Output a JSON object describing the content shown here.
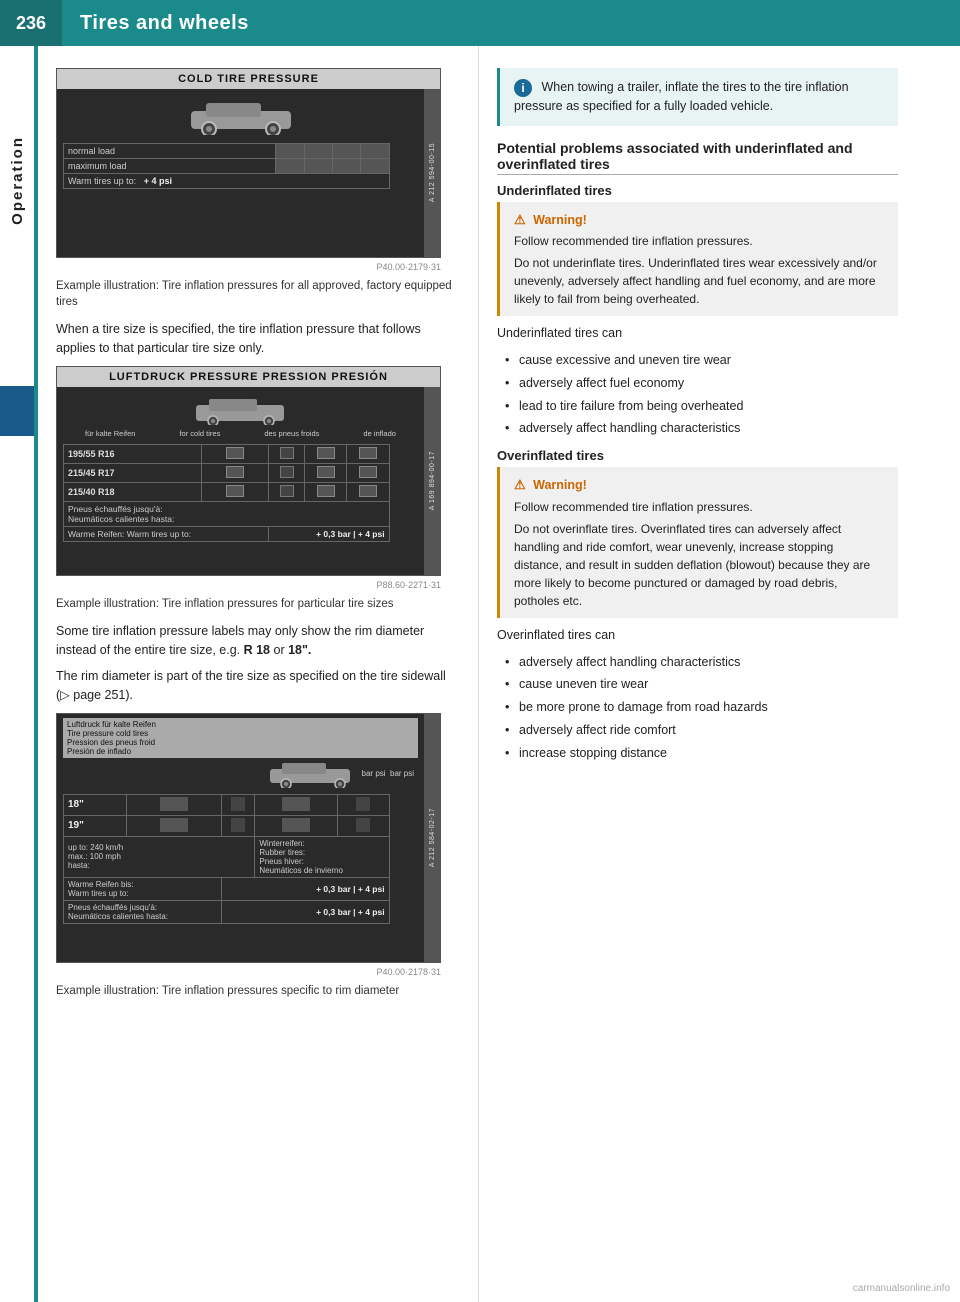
{
  "header": {
    "page_number": "236",
    "title": "Tires and wheels"
  },
  "sidebar": {
    "label": "Operation",
    "marker_visible": true
  },
  "left_col": {
    "diagram1": {
      "title": "COLD TIRE PRESSURE",
      "ref": "P40.00·2179·31",
      "caption": "Example illustration: Tire inflation pressures for all approved, factory equipped tires"
    },
    "body1": "When a tire size is specified, the tire inflation pressure that follows applies to that particular tire size only.",
    "diagram2": {
      "title": "LUFTDRUCK PRESSURE PRESSION PRESIÓN",
      "headers": [
        "für kalte Reifen",
        "for cold tires",
        "des pneus froids",
        "de inflado"
      ],
      "rows": [
        {
          "size": "195/55 R16",
          "vals": [
            "",
            "",
            "",
            ""
          ]
        },
        {
          "size": "215/45 R17",
          "vals": [
            "",
            "",
            "",
            ""
          ]
        },
        {
          "size": "215/40 R18",
          "vals": [
            "",
            "",
            "",
            ""
          ]
        }
      ],
      "footer_left": "Warme Reifen: Warm tires up to:",
      "footer_right": "+ 0,3 bar | + 4 psi",
      "ref": "P88.60·2271·31",
      "caption": "Example illustration: Tire inflation pressures for particular tire sizes"
    },
    "body2": "Some tire inflation pressure labels may only show the rim diameter instead of the entire tire size, e.g.",
    "body2_bold_part1": "R 18",
    "body2_or": "or",
    "body2_bold_part2": "18\".",
    "body3": "The rim diameter is part of the tire size as specified on the tire sidewall (▷ page 251).",
    "diagram3": {
      "ref": "P40.00·2178·31",
      "caption": "Example illustration: Tire inflation pressures specific to rim diameter"
    }
  },
  "right_col": {
    "info_box": {
      "text": "When towing a trailer, inflate the tires to the tire inflation pressure as specified for a fully loaded vehicle."
    },
    "section_heading": "Potential problems associated with underinflated and overinflated tires",
    "underinflated": {
      "sub_heading": "Underinflated tires",
      "warning_title": "Warning!",
      "warning_lines": [
        "Follow recommended tire inflation pressures.",
        "Do not underinflate tires. Underinflated tires wear excessively and/or unevenly, adversely affect handling and fuel economy, and are more likely to fail from being overheated."
      ],
      "intro": "Underinflated tires can",
      "bullets": [
        "cause excessive and uneven tire wear",
        "adversely affect fuel economy",
        "lead to tire failure from being overheated",
        "adversely affect handling characteristics"
      ]
    },
    "overinflated": {
      "sub_heading": "Overinflated tires",
      "warning_title": "Warning!",
      "warning_lines": [
        "Follow recommended tire inflation pressures.",
        "Do not overinflate tires. Overinflated tires can adversely affect handling and ride comfort, wear unevenly, increase stopping distance, and result in sudden deflation (blowout) because they are more likely to become punctured or damaged by road debris, potholes etc."
      ],
      "intro": "Overinflated tires can",
      "bullets": [
        "adversely affect handling characteristics",
        "cause uneven tire wear",
        "be more prone to damage from road hazards",
        "adversely affect ride comfort",
        "increase stopping distance"
      ]
    }
  },
  "watermark": "carmanualsonline.info"
}
